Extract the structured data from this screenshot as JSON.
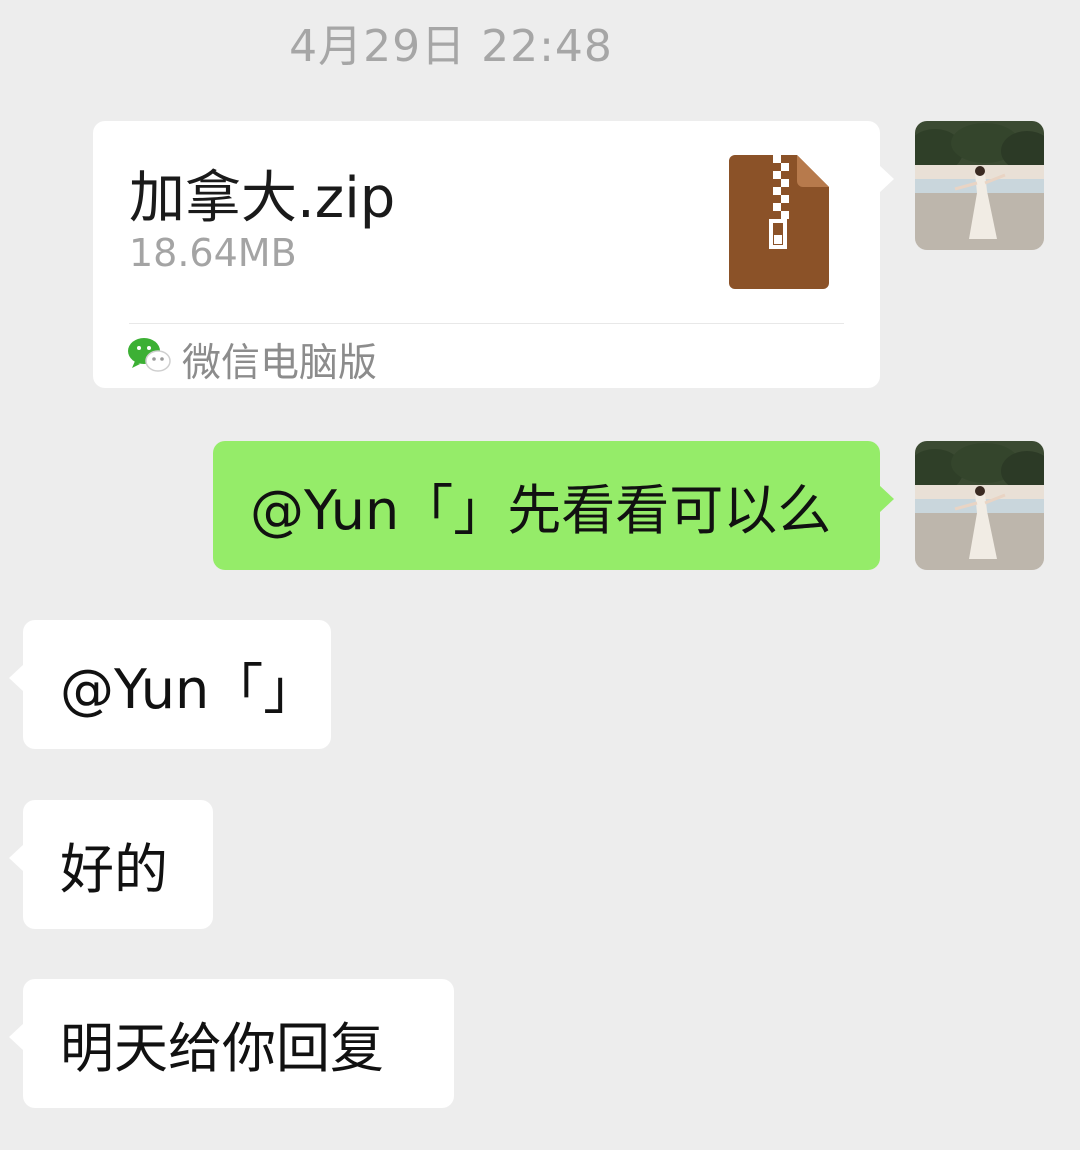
{
  "chat": {
    "timestamp": "4月29日 22:48",
    "file_message": {
      "file_name": "加拿大.zip",
      "file_size": "18.64MB",
      "file_icon": "zip-archive-icon",
      "icon_color": "#8b5228",
      "source_icon": "wechat-icon",
      "source_label": "微信电脑版"
    },
    "messages": [
      {
        "direction": "outgoing",
        "text": "@Yun「」先看看可以么"
      },
      {
        "direction": "incoming",
        "text": "@Yun「」"
      },
      {
        "direction": "incoming",
        "text": "好的"
      },
      {
        "direction": "incoming",
        "text": "明天给你回复"
      }
    ],
    "colors": {
      "background": "#ededed",
      "outgoing_bubble": "#95ec69",
      "incoming_bubble": "#ffffff"
    }
  }
}
